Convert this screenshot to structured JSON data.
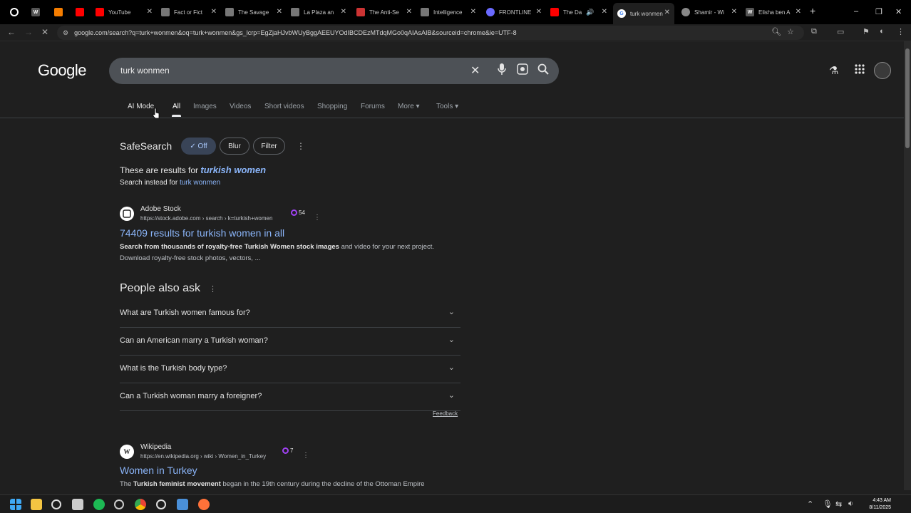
{
  "tabs": [
    {
      "label": "",
      "icon": "github-icon",
      "color": "#ffffff"
    },
    {
      "label": "",
      "icon": "wikipedia-icon",
      "color": "#ffffff"
    },
    {
      "label": "",
      "icon": "blogger-icon",
      "color": "#f57d00"
    },
    {
      "label": "",
      "icon": "youtube-icon",
      "color": "#ff0000"
    },
    {
      "label": "YouTube",
      "icon": "youtube-icon",
      "color": "#ff0000"
    },
    {
      "label": "Fact or Fict",
      "icon": "page-icon",
      "color": "#cccccc"
    },
    {
      "label": "The Savage",
      "icon": "page-icon",
      "color": "#cccccc"
    },
    {
      "label": "La Plaza an",
      "icon": "page-icon",
      "color": "#cccccc"
    },
    {
      "label": "The Anti-Se",
      "icon": "page-icon",
      "color": "#cc3333"
    },
    {
      "label": "Intelligence",
      "icon": "page-icon",
      "color": "#cccccc"
    },
    {
      "label": "FRONTLINE",
      "icon": "page-icon",
      "color": "#8888ff"
    },
    {
      "label": "The Da",
      "icon": "youtube-icon",
      "color": "#ff0000"
    },
    {
      "label": "turk wonmen",
      "icon": "google-icon",
      "color": "#4285f4"
    },
    {
      "label": "Shamir - Wi",
      "icon": "globe-icon",
      "color": "#cccccc"
    },
    {
      "label": "Elisha ben A",
      "icon": "wikipedia-icon",
      "color": "#ffffff"
    }
  ],
  "address_bar": {
    "url": "google.com/search?q=turk+wonmen&oq=turk+wonmen&gs_lcrp=EgZjaHJvbWUyBggAEEUYOdIBCDEzMTdqMGo0qAIAsAIB&sourceid=chrome&ie=UTF-8"
  },
  "google": {
    "logo": "Google",
    "query": "turk wonmen"
  },
  "nav_tabs": [
    "AI Mode",
    "All",
    "Images",
    "Videos",
    "Short videos",
    "Shopping",
    "Forums",
    "More ▾",
    "Tools ▾"
  ],
  "safesearch": {
    "label": "SafeSearch",
    "off": "✓ Off",
    "blur": "Blur",
    "filter": "Filter"
  },
  "correction": {
    "prefix": "These are results for",
    "corrected": "turkish women",
    "instead_prefix": "Search instead for",
    "instead_link": "turk wonmen"
  },
  "result1": {
    "source": "Adobe Stock",
    "url": "https://stock.adobe.com › search › k=turkish+women",
    "badge": "54",
    "title": "74409 results for turkish women in all",
    "snippet_bold": "Search from thousands of royalty-free Turkish Women stock images",
    "snippet_rest": " and video for your next project.",
    "snippet_line2": "Download royalty-free stock photos, vectors, ..."
  },
  "people_also_ask": {
    "title": "People also ask",
    "questions": [
      "What are Turkish women famous for?",
      "Can an American marry a Turkish woman?",
      "What is the Turkish body type?",
      "Can a Turkish woman marry a foreigner?"
    ],
    "feedback": "Feedback"
  },
  "result2": {
    "source": "Wikipedia",
    "favicon": "W",
    "url": "https://en.wikipedia.org › wiki › Women_in_Turkey",
    "badge": "7",
    "title": "Women in Turkey",
    "snippet_pre": "The ",
    "snippet_bold": "Turkish feminist movement",
    "snippet_rest": " began in the 19th century during the decline of the Ottoman Empire"
  },
  "clock": {
    "time": "4:43 AM",
    "date": "8/11/2025"
  }
}
